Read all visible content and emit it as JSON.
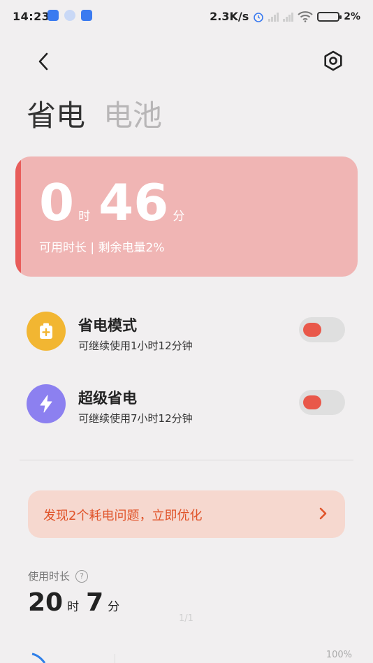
{
  "status_bar": {
    "time": "14:23",
    "net_speed": "2.3K/s",
    "battery_percent": "2%"
  },
  "tabs": {
    "active": "省电",
    "inactive": "电池"
  },
  "battery_card": {
    "hours": "0",
    "hours_unit": "时",
    "minutes": "46",
    "minutes_unit": "分",
    "subtitle": "可用时长 | 剩余电量2%",
    "accent_color": "#e85d5b",
    "background_color": "#f0b5b4"
  },
  "modes": [
    {
      "title": "省电模式",
      "subtitle": "可继续使用1小时12分钟",
      "icon": "battery-plus-icon",
      "icon_color": "#f2b632",
      "enabled": false
    },
    {
      "title": "超级省电",
      "subtitle": "可继续使用7小时12分钟",
      "icon": "lightning-icon",
      "icon_color": "#8c80f0",
      "enabled": false
    }
  ],
  "optimize": {
    "text": "发现2个耗电问题，立即优化",
    "color": "#e0542a"
  },
  "usage": {
    "label": "使用时长",
    "hours": "20",
    "hours_unit": "时",
    "minutes": "7",
    "minutes_unit": "分"
  },
  "pager": "1/1",
  "chart_max_label": "100%"
}
